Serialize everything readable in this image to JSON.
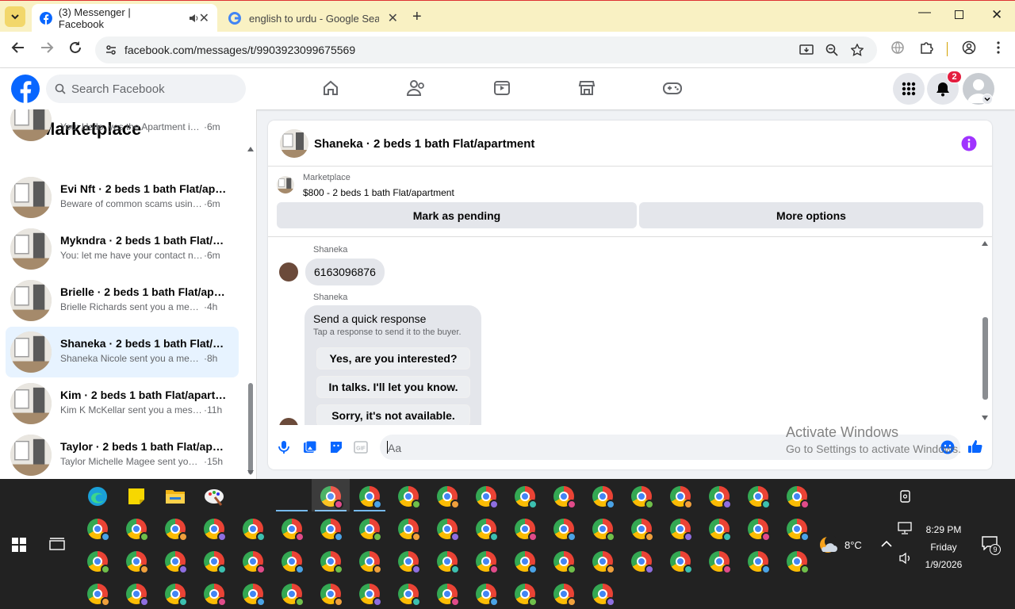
{
  "browser": {
    "tabs": [
      {
        "title": "(3) Messenger | Facebook",
        "active": true
      },
      {
        "title": "english to urdu - Google Search",
        "active": false
      }
    ],
    "url": "facebook.com/messages/t/9903923099675569"
  },
  "fb": {
    "search_placeholder": "Search Facebook",
    "notification_count": "2"
  },
  "marketplace": {
    "title": "Marketplace",
    "conversations": [
      {
        "name": "",
        "preview": "You: Hello, yes the Apartment is sti...",
        "time": "·6m",
        "selected": false
      },
      {
        "name": "Evi Nft · 2 beds 1 bath Flat/apart...",
        "preview": "Beware of common scams using p...",
        "time": "·6m",
        "selected": false
      },
      {
        "name": "Mykndra · 2 beds 1 bath Flat/ap...",
        "preview": "You: let me have your contact nu...",
        "time": "·6m",
        "selected": false
      },
      {
        "name": "Brielle · 2 beds 1 bath Flat/apart...",
        "preview": "Brielle Richards sent you a messag...",
        "time": "·4h",
        "selected": false
      },
      {
        "name": "Shaneka · 2 beds 1 bath Flat/apa...",
        "preview": "Shaneka Nicole sent you a messag...",
        "time": "·8h",
        "selected": true
      },
      {
        "name": "Kim · 2 beds 1 bath Flat/apartm...",
        "preview": "Kim K McKellar sent you a messag...",
        "time": "·11h",
        "selected": false
      },
      {
        "name": "Taylor · 2 beds 1 bath Flat/apart...",
        "preview": "Taylor Michelle Magee sent you a ...",
        "time": "·15h",
        "selected": false
      }
    ]
  },
  "chat": {
    "title": "Shaneka · 2 beds 1 bath Flat/apartment",
    "listing_label": "Marketplace",
    "listing_price": "$800 - 2 beds 1 bath Flat/apartment",
    "mark_pending": "Mark as pending",
    "more_options": "More options",
    "messages": {
      "sender1": "Shaneka",
      "phone": "6163096876",
      "sender2": "Shaneka",
      "quick_title": "Send a quick response",
      "quick_sub": "Tap a response to send it to the buyer.",
      "quick_replies": [
        "Yes, are you interested?",
        "In talks. I'll let you know.",
        "Sorry, it's not available."
      ]
    },
    "composer_placeholder": "Aa"
  },
  "watermark": {
    "line1": "Activate Windows",
    "line2": "Go to Settings to activate Windows."
  },
  "taskbar": {
    "temperature": "8°C",
    "time": "8:29 PM",
    "day": "Friday",
    "date": "1/9/2026",
    "notif_count": "9"
  },
  "colors": {
    "fb_blue": "#0866ff",
    "accent_purple": "#a033ff",
    "badge_red": "#e41e3f"
  }
}
